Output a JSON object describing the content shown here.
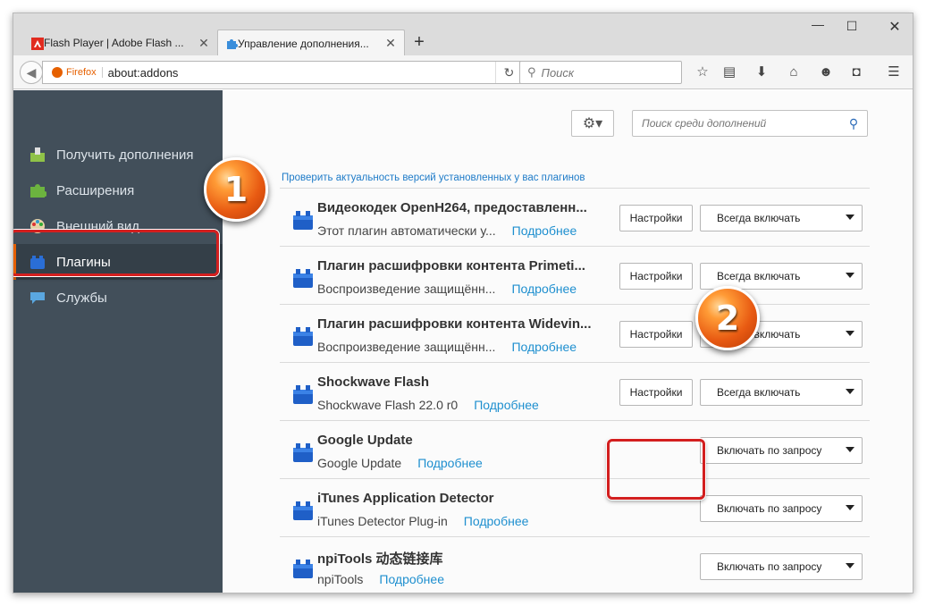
{
  "tabs": [
    {
      "label": "Flash Player | Adobe Flash ...",
      "close": "✕"
    },
    {
      "label": "Управление дополнения...",
      "close": "✕"
    }
  ],
  "window_controls": {
    "minimize": "—",
    "maximize": "☐",
    "close": "✕"
  },
  "newtab_label": "+",
  "navbar": {
    "identity": "Firefox",
    "url": "about:addons",
    "search_placeholder": "Поиск"
  },
  "sidebar": {
    "items": [
      {
        "label": "Получить дополнения",
        "icon": "get-addons-icon"
      },
      {
        "label": "Расширения",
        "icon": "puzzle-icon"
      },
      {
        "label": "Внешний вид",
        "icon": "palette-icon"
      },
      {
        "label": "Плагины",
        "icon": "plugin-icon",
        "selected": true
      },
      {
        "label": "Службы",
        "icon": "speech-bubble-icon"
      }
    ]
  },
  "main": {
    "search_placeholder": "Поиск среди дополнений",
    "check_link": "Проверить актуальность версий установленных у вас плагинов",
    "settings_label": "Настройки",
    "more_label": "Подробнее",
    "plugins": [
      {
        "name": "Видеокодек OpenH264, предоставленн...",
        "desc": "Этот плагин автоматически у...",
        "state": "Всегда включать",
        "has_settings": true
      },
      {
        "name": "Плагин расшифровки контента Primeti...",
        "desc": "Воспроизведение защищённ...",
        "state": "Всегда включать",
        "has_settings": true
      },
      {
        "name": "Плагин расшифровки контента Widevin...",
        "desc": "Воспроизведение защищённ...",
        "state": "Всегда включать",
        "has_settings": true
      },
      {
        "name": "Shockwave Flash",
        "desc": "Shockwave Flash 22.0 r0",
        "state": "Всегда включать",
        "has_settings": true
      },
      {
        "name": "Google Update",
        "desc": "Google Update",
        "state": "Включать по запросу",
        "has_settings": false
      },
      {
        "name": "iTunes Application Detector",
        "desc": "iTunes Detector Plug-in",
        "state": "Включать по запросу",
        "has_settings": false
      },
      {
        "name": "npiTools 动态链接库",
        "desc": "npiTools",
        "state": "Включать по запросу",
        "has_settings": false
      }
    ]
  },
  "markers": [
    "1",
    "2"
  ],
  "colors": {
    "accent": "#e66000",
    "link": "#1e8fcf",
    "sidebar": "#424f5a",
    "highlight": "#d31f1f"
  }
}
